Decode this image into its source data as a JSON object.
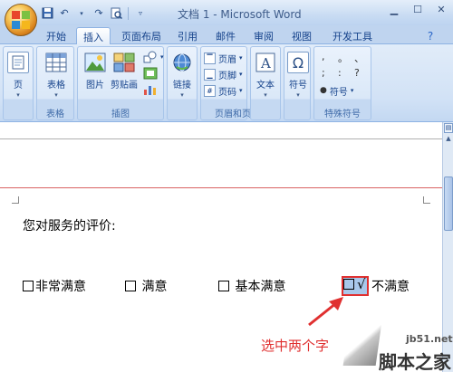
{
  "window": {
    "title": "文档 1 - Microsoft Word"
  },
  "qat": {
    "undo_label": "↶",
    "redo_label": "↷"
  },
  "tabs": [
    {
      "label": "开始"
    },
    {
      "label": "插入"
    },
    {
      "label": "页面布局"
    },
    {
      "label": "引用"
    },
    {
      "label": "邮件"
    },
    {
      "label": "审阅"
    },
    {
      "label": "视图"
    },
    {
      "label": "开发工具"
    }
  ],
  "ribbon": {
    "pages": {
      "button": "页",
      "group": ""
    },
    "tables": {
      "button": "表格",
      "group": "表格"
    },
    "illustrations": {
      "picture": "图片",
      "clipart": "剪贴画",
      "group": "插图"
    },
    "links": {
      "button": "链接"
    },
    "header_footer": {
      "header": "页眉",
      "footer": "页脚",
      "page_number": "页码",
      "group": "页眉和页脚"
    },
    "text": {
      "button": "文本"
    },
    "symbols": {
      "button": "符号"
    },
    "special": {
      "symbol_button": "符号",
      "group": "特殊符号",
      "chars": [
        ",",
        "。",
        "、",
        ";",
        ":",
        "?"
      ]
    }
  },
  "document": {
    "question": "您对服务的评价:",
    "options": [
      "非常满意",
      "满意",
      "基本满意",
      "不满意"
    ],
    "check_mark": "√",
    "annotation": "选中两个字"
  },
  "watermark": {
    "url": "jb51.net",
    "name": "脚本之家"
  },
  "colors": {
    "accent": "#15428b",
    "annotation": "#e03030",
    "highlight": "#a9c7ea"
  }
}
